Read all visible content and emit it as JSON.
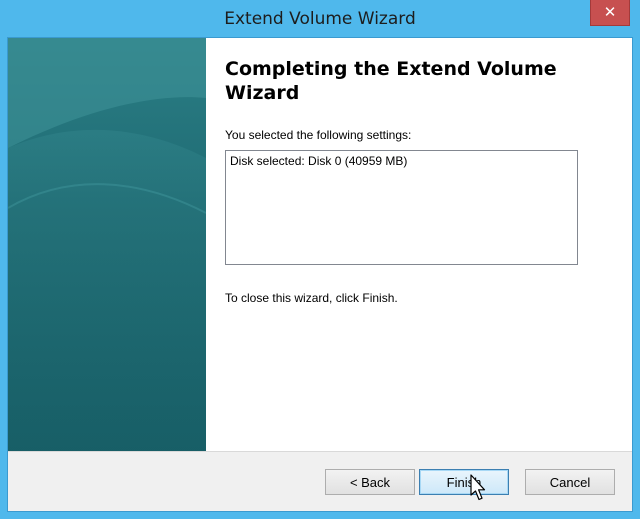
{
  "window": {
    "title": "Extend Volume Wizard",
    "close_symbol": "✕"
  },
  "wizard": {
    "heading": "Completing the Extend Volume Wizard",
    "settings_label": "You selected the following settings:",
    "settings": [
      "Disk selected: Disk 0 (40959 MB)"
    ],
    "close_instruction": "To close this wizard, click Finish."
  },
  "buttons": {
    "back": "< Back",
    "finish": "Finish",
    "cancel": "Cancel"
  },
  "colors": {
    "frame": "#4fb8ec",
    "side_panel": "#1f6b73",
    "close_button": "#c75050"
  },
  "icons": {
    "close": "close-icon",
    "cursor": "mouse-pointer-icon"
  }
}
